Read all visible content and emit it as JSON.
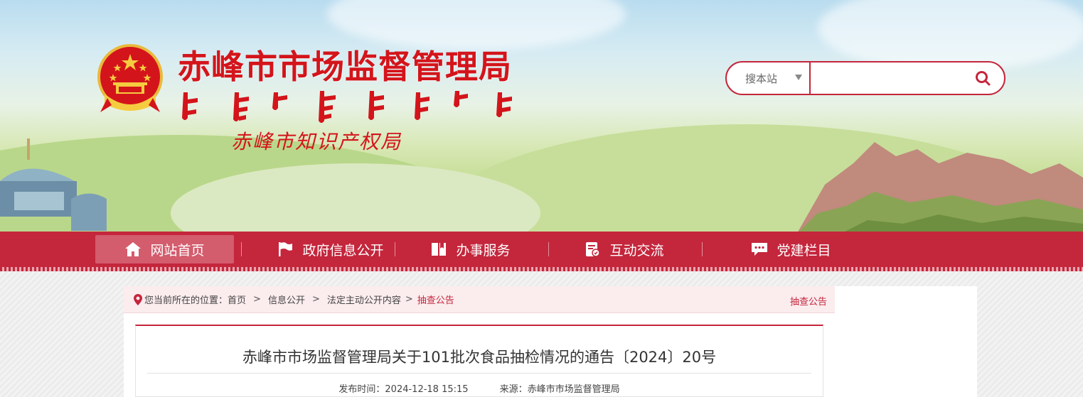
{
  "header": {
    "site_title": "赤峰市市场监督管理局",
    "sub_title": "赤峰市知识产权局"
  },
  "search": {
    "scope_label": "搜本站",
    "value": "",
    "placeholder": ""
  },
  "nav": {
    "items": [
      {
        "label": "网站首页",
        "icon": "home-icon"
      },
      {
        "label": "政府信息公开",
        "icon": "flag-icon"
      },
      {
        "label": "办事服务",
        "icon": "book-icon"
      },
      {
        "label": "互动交流",
        "icon": "chat-doc-icon"
      },
      {
        "label": "党建栏目",
        "icon": "speech-bubble-icon"
      }
    ]
  },
  "breadcrumb": {
    "prefix": "您当前所在的位置：",
    "items": [
      "首页",
      "信息公开",
      "法定主动公开内容",
      "抽查公告"
    ],
    "section_label": "抽查公告"
  },
  "article": {
    "title": "赤峰市市场监督管理局关于101批次食品抽检情况的通告〔2024〕20号",
    "publish_time": "发布时间：2024-12-18 15:15",
    "source": "来源：赤峰市市场监督管理局"
  },
  "colors": {
    "brand_red": "#c4263c",
    "title_red": "#d4141b"
  }
}
